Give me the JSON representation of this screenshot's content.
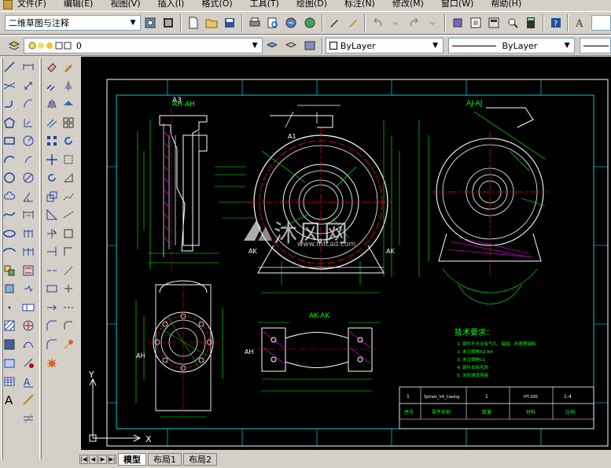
{
  "menu": {
    "items": [
      "文件(F)",
      "编辑(E)",
      "视图(V)",
      "插入(I)",
      "格式(O)",
      "工具(T)",
      "绘图(D)",
      "标注(N)",
      "修改(M)",
      "窗口(W)",
      "帮助(H)"
    ]
  },
  "workspace": {
    "value": "二维草图与注释"
  },
  "layer": {
    "value": "0"
  },
  "properties": {
    "color": "ByLayer",
    "linetype": "ByLayer"
  },
  "tabs": {
    "model": "模型",
    "layout1": "布局1",
    "layout2": "布局2"
  },
  "drawing": {
    "view_a3": "A3",
    "view_ah": "AH-AH",
    "view_aj": "AJ-AJ",
    "view_ak": "AK-AK",
    "label_ak": "AK",
    "label_a1": "A1",
    "label_ah": "AH",
    "label_aj": "AJ",
    "tech_title": "技术要求：",
    "tech_notes": [
      "1. 铸件不允许有气孔、裂纹、砂眼等缺陷",
      "2. 未注圆角R2-R4",
      "3. 未注倒角C1",
      "4. 铸件去除毛刺",
      "5. 涂防锈漆两遍"
    ],
    "title_block": {
      "row_no": "1",
      "part_name": "Spirals_V4_Casing",
      "code": "HT-200",
      "qty": "1",
      "scale": "1:4",
      "h_seq": "序号",
      "h_name": "零件名称",
      "h_qty": "数量",
      "h_mat": "材料",
      "h_scale": "比例"
    },
    "ucs_x": "X",
    "ucs_y": "Y"
  },
  "watermark": {
    "text": "沐风网",
    "url": "www.mfcad.com"
  },
  "colors": {
    "canvas": "#000000",
    "frame": "#00ffff",
    "geometry": "#ffffff",
    "dimension": "#00ff00",
    "centerline": "#ff0000",
    "section_hatch": "#ff00ff"
  }
}
